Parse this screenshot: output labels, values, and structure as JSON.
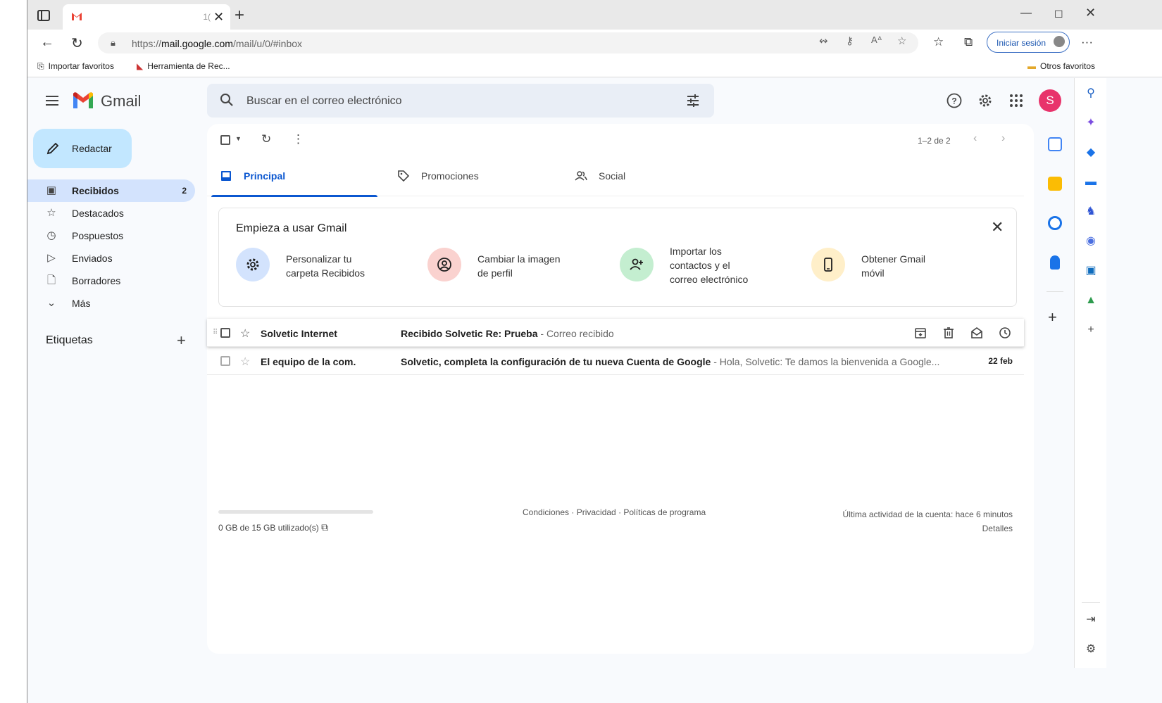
{
  "browser": {
    "tab_title": "",
    "tab_counter": "1(",
    "url_prefix": "https://",
    "url_domain": "mail.google.com",
    "url_path": "/mail/u/0/#inbox",
    "signin_label": "Iniciar sesión",
    "bookmarks": [
      "Importar favoritos",
      "Herramienta de Rec..."
    ],
    "other_favorites": "Otros favoritos"
  },
  "gmail": {
    "logo_text": "Gmail",
    "search_placeholder": "Buscar en el correo electrónico",
    "avatar_letter": "S",
    "compose_label": "Redactar",
    "nav": [
      {
        "label": "Recibidos",
        "count": "2",
        "icon": "inbox-icon"
      },
      {
        "label": "Destacados",
        "count": "",
        "icon": "star-icon"
      },
      {
        "label": "Pospuestos",
        "count": "",
        "icon": "clock-icon"
      },
      {
        "label": "Enviados",
        "count": "",
        "icon": "send-icon"
      },
      {
        "label": "Borradores",
        "count": "",
        "icon": "draft-icon"
      },
      {
        "label": "Más",
        "count": "",
        "icon": "chevron-down-icon"
      }
    ],
    "labels_title": "Etiquetas",
    "pager_text": "1–2 de 2",
    "tabs": [
      "Principal",
      "Promociones",
      "Social"
    ],
    "getting_started": {
      "title": "Empieza a usar Gmail",
      "items": [
        {
          "line1": "Personalizar tu",
          "line2": "carpeta Recibidos",
          "line3": ""
        },
        {
          "line1": "Cambiar la imagen",
          "line2": "de perfil",
          "line3": ""
        },
        {
          "line1": "Importar los",
          "line2": "contactos y el",
          "line3": "correo electrónico"
        },
        {
          "line1": "Obtener Gmail",
          "line2": "móvil",
          "line3": ""
        }
      ]
    },
    "emails": [
      {
        "sender": "Solvetic Internet",
        "subject": "Recibido Solvetic Re: Prueba",
        "snippet": " - Correo recibido",
        "date": ""
      },
      {
        "sender": "El equipo de la com.",
        "subject": "Solvetic, completa la configuración de tu nueva Cuenta de Google",
        "snippet": " - Hola, Solvetic: Te damos la bienvenida a Google...",
        "date": "22 feb"
      }
    ],
    "storage_text": "0 GB de 15 GB utilizado(s)",
    "footer_links": "Condiciones · Privacidad · Políticas de programa",
    "last_activity": "Última actividad de la cuenta: hace 6 minutos",
    "details": "Detalles"
  },
  "colors": {
    "accent": "#0b57d0",
    "compose_bg": "#c2e7ff",
    "active_nav": "#d3e3fd",
    "avatar": "#e8336b"
  }
}
